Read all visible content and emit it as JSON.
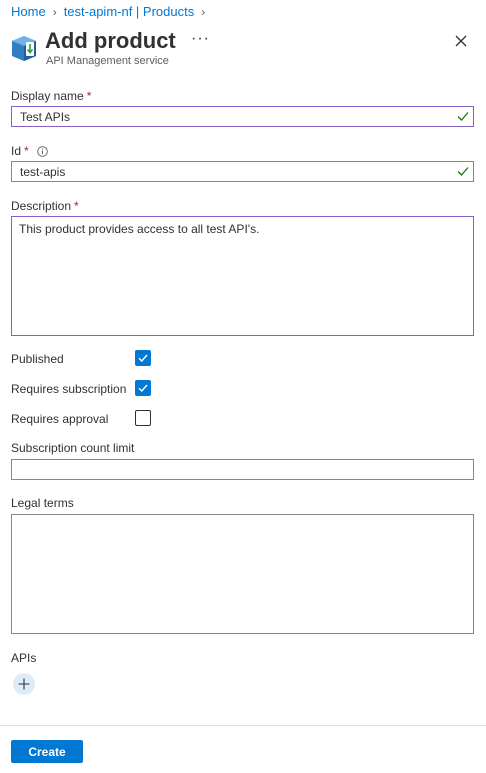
{
  "breadcrumb": {
    "items": [
      "Home",
      "test-apim-nf | Products"
    ],
    "separator": "›"
  },
  "header": {
    "title": "Add product",
    "subtitle": "API Management service",
    "more_label": "···",
    "icons": [
      "product-cube-icon",
      "more-icon",
      "close-icon"
    ]
  },
  "form": {
    "display_name": {
      "label": "Display name",
      "required_mark": "*",
      "value": "Test APIs",
      "valid": true
    },
    "id": {
      "label": "Id",
      "required_mark": "*",
      "value": "test-apis",
      "valid": true,
      "icon": "info-icon"
    },
    "description": {
      "label": "Description",
      "required_mark": "*",
      "value": "This product provides access to all test API's."
    },
    "published": {
      "label": "Published",
      "checked": true
    },
    "requires_subscription": {
      "label": "Requires subscription",
      "checked": true
    },
    "requires_approval": {
      "label": "Requires approval",
      "checked": false
    },
    "subscription_count_limit": {
      "label": "Subscription count limit",
      "value": ""
    },
    "legal_terms": {
      "label": "Legal terms",
      "value": ""
    },
    "apis": {
      "label": "APIs",
      "add_icon": "plus-icon"
    }
  },
  "footer": {
    "create_label": "Create"
  },
  "colors": {
    "accent": "#0078d4",
    "valid_border": "#8661c5",
    "valid_check": "#107c10",
    "required": "#a4262c"
  }
}
